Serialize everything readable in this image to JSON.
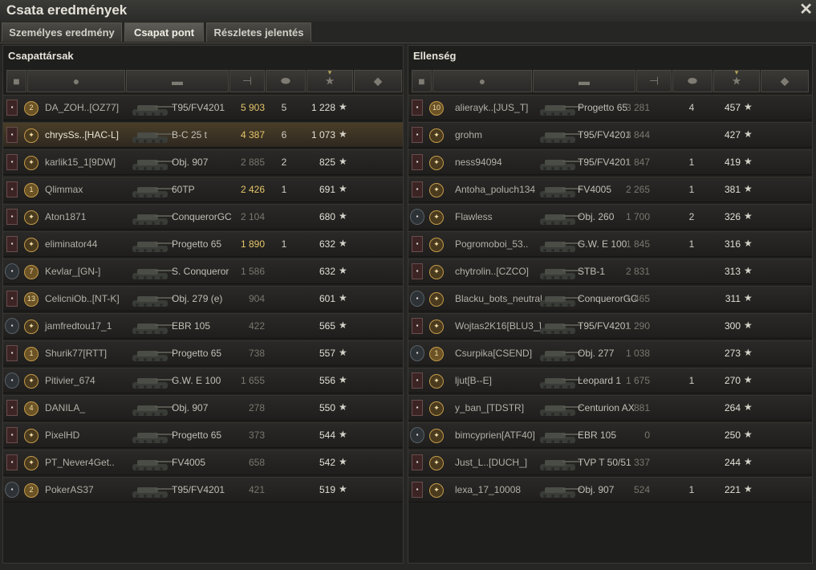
{
  "window": {
    "title": "Csata eredmények"
  },
  "tabs": [
    {
      "label": "Személyes eredmény",
      "active": false
    },
    {
      "label": "Csapat pont",
      "active": true
    },
    {
      "label": "Részletes jelentés",
      "active": false
    }
  ],
  "icons": {
    "close": "close-icon",
    "star": "★"
  },
  "teams": [
    {
      "title": "Csapattársak",
      "players": [
        {
          "name": "DA_ZOH..[OZ77]",
          "vehicle": "T95/FV4201",
          "damage": "5 903",
          "kills": "5",
          "xp": "1 228",
          "badge": "2",
          "me": false,
          "hi": true
        },
        {
          "name": "chrysSs..[HAC-L]",
          "vehicle": "B-C 25 t",
          "damage": "4 387",
          "kills": "6",
          "xp": "1 073",
          "badge": "",
          "me": true,
          "hi": true
        },
        {
          "name": "karlik15_1[9DW]",
          "vehicle": "Obj. 907",
          "damage": "2 885",
          "kills": "2",
          "xp": "825",
          "badge": "",
          "me": false,
          "hi": false
        },
        {
          "name": "Qlimmax",
          "vehicle": "60TP",
          "damage": "2 426",
          "kills": "1",
          "xp": "691",
          "badge": "1",
          "me": false,
          "hi": true
        },
        {
          "name": "Aton1871",
          "vehicle": "ConquerorGC",
          "damage": "2 104",
          "kills": "",
          "xp": "680",
          "badge": "",
          "me": false,
          "hi": false
        },
        {
          "name": "eliminator44",
          "vehicle": "Progetto 65",
          "damage": "1 890",
          "kills": "1",
          "xp": "632",
          "badge": "",
          "me": false,
          "hi": true
        },
        {
          "name": "Kevlar_[GN-]",
          "vehicle": "S. Conqueror",
          "damage": "1 586",
          "kills": "",
          "xp": "632",
          "badge": "7",
          "me": false,
          "hi": false
        },
        {
          "name": "CelicniOb..[NT-K]",
          "vehicle": "Obj. 279 (e)",
          "damage": "904",
          "kills": "",
          "xp": "601",
          "badge": "13",
          "me": false,
          "hi": false
        },
        {
          "name": "jamfredtou17_1",
          "vehicle": "EBR 105",
          "damage": "422",
          "kills": "",
          "xp": "565",
          "badge": "",
          "me": false,
          "hi": false
        },
        {
          "name": "Shurik77[RTT]",
          "vehicle": "Progetto 65",
          "damage": "738",
          "kills": "",
          "xp": "557",
          "badge": "1",
          "me": false,
          "hi": false
        },
        {
          "name": "Pitivier_674",
          "vehicle": "G.W. E 100",
          "damage": "1 655",
          "kills": "",
          "xp": "556",
          "badge": "",
          "me": false,
          "hi": false
        },
        {
          "name": "DANILA_",
          "vehicle": "Obj. 907",
          "damage": "278",
          "kills": "",
          "xp": "550",
          "badge": "4",
          "me": false,
          "hi": false
        },
        {
          "name": "PixelHD",
          "vehicle": "Progetto 65",
          "damage": "373",
          "kills": "",
          "xp": "544",
          "badge": "",
          "me": false,
          "hi": false
        },
        {
          "name": "PT_Never4Get..",
          "vehicle": "FV4005",
          "damage": "658",
          "kills": "",
          "xp": "542",
          "badge": "",
          "me": false,
          "hi": false
        },
        {
          "name": "PokerAS37",
          "vehicle": "T95/FV4201",
          "damage": "421",
          "kills": "",
          "xp": "519",
          "badge": "2",
          "me": false,
          "hi": false
        }
      ]
    },
    {
      "title": "Ellenség",
      "players": [
        {
          "name": "alierayk..[JUS_T]",
          "vehicle": "Progetto 65",
          "damage": "3 281",
          "kills": "4",
          "xp": "457",
          "badge": "10",
          "me": false,
          "hi": false
        },
        {
          "name": "grohm",
          "vehicle": "T95/FV4201",
          "damage": "3 844",
          "kills": "",
          "xp": "427",
          "badge": "",
          "me": false,
          "hi": false
        },
        {
          "name": "ness94094",
          "vehicle": "T95/FV4201",
          "damage": "1 847",
          "kills": "1",
          "xp": "419",
          "badge": "",
          "me": false,
          "hi": false
        },
        {
          "name": "Antoha_poluch134",
          "vehicle": "FV4005",
          "damage": "2 265",
          "kills": "1",
          "xp": "381",
          "badge": "",
          "me": false,
          "hi": false
        },
        {
          "name": "Flawless",
          "vehicle": "Obj. 260",
          "damage": "1 700",
          "kills": "2",
          "xp": "326",
          "badge": "",
          "me": false,
          "hi": false
        },
        {
          "name": "Pogromoboi_53..",
          "vehicle": "G.W. E 100",
          "damage": "1 845",
          "kills": "1",
          "xp": "316",
          "badge": "",
          "me": false,
          "hi": false
        },
        {
          "name": "chytrolin..[CZCO]",
          "vehicle": "STB-1",
          "damage": "2 831",
          "kills": "",
          "xp": "313",
          "badge": "",
          "me": false,
          "hi": false
        },
        {
          "name": "Blacku_bots_neutral..",
          "vehicle": "ConquerorGC",
          "damage": "1 465",
          "kills": "",
          "xp": "311",
          "badge": "",
          "me": false,
          "hi": false
        },
        {
          "name": "Wojtas2K16[BLU3_]",
          "vehicle": "T95/FV4201",
          "damage": "1 290",
          "kills": "",
          "xp": "300",
          "badge": "",
          "me": false,
          "hi": false
        },
        {
          "name": "Csurpika[CSEND]",
          "vehicle": "Obj. 277",
          "damage": "1 038",
          "kills": "",
          "xp": "273",
          "badge": "1",
          "me": false,
          "hi": false
        },
        {
          "name": "ljut[B--E]",
          "vehicle": "Leopard 1",
          "damage": "1 675",
          "kills": "1",
          "xp": "270",
          "badge": "",
          "me": false,
          "hi": false
        },
        {
          "name": "y_ban_[TDSTR]",
          "vehicle": "Centurion AX",
          "damage": "881",
          "kills": "",
          "xp": "264",
          "badge": "",
          "me": false,
          "hi": false
        },
        {
          "name": "bimcyprien[ATF40]",
          "vehicle": "EBR 105",
          "damage": "0",
          "kills": "",
          "xp": "250",
          "badge": "",
          "me": false,
          "hi": false
        },
        {
          "name": "Just_L..[DUCH_]",
          "vehicle": "TVP T 50/51",
          "damage": "337",
          "kills": "",
          "xp": "244",
          "badge": "",
          "me": false,
          "hi": false
        },
        {
          "name": "lexa_17_10008",
          "vehicle": "Obj. 907",
          "damage": "524",
          "kills": "1",
          "xp": "221",
          "badge": "",
          "me": false,
          "hi": false
        }
      ]
    }
  ],
  "colors": {
    "highlight_damage": "#e6c66a",
    "dim_damage": "#7a776f",
    "enemy_damage": "#7a776f"
  }
}
